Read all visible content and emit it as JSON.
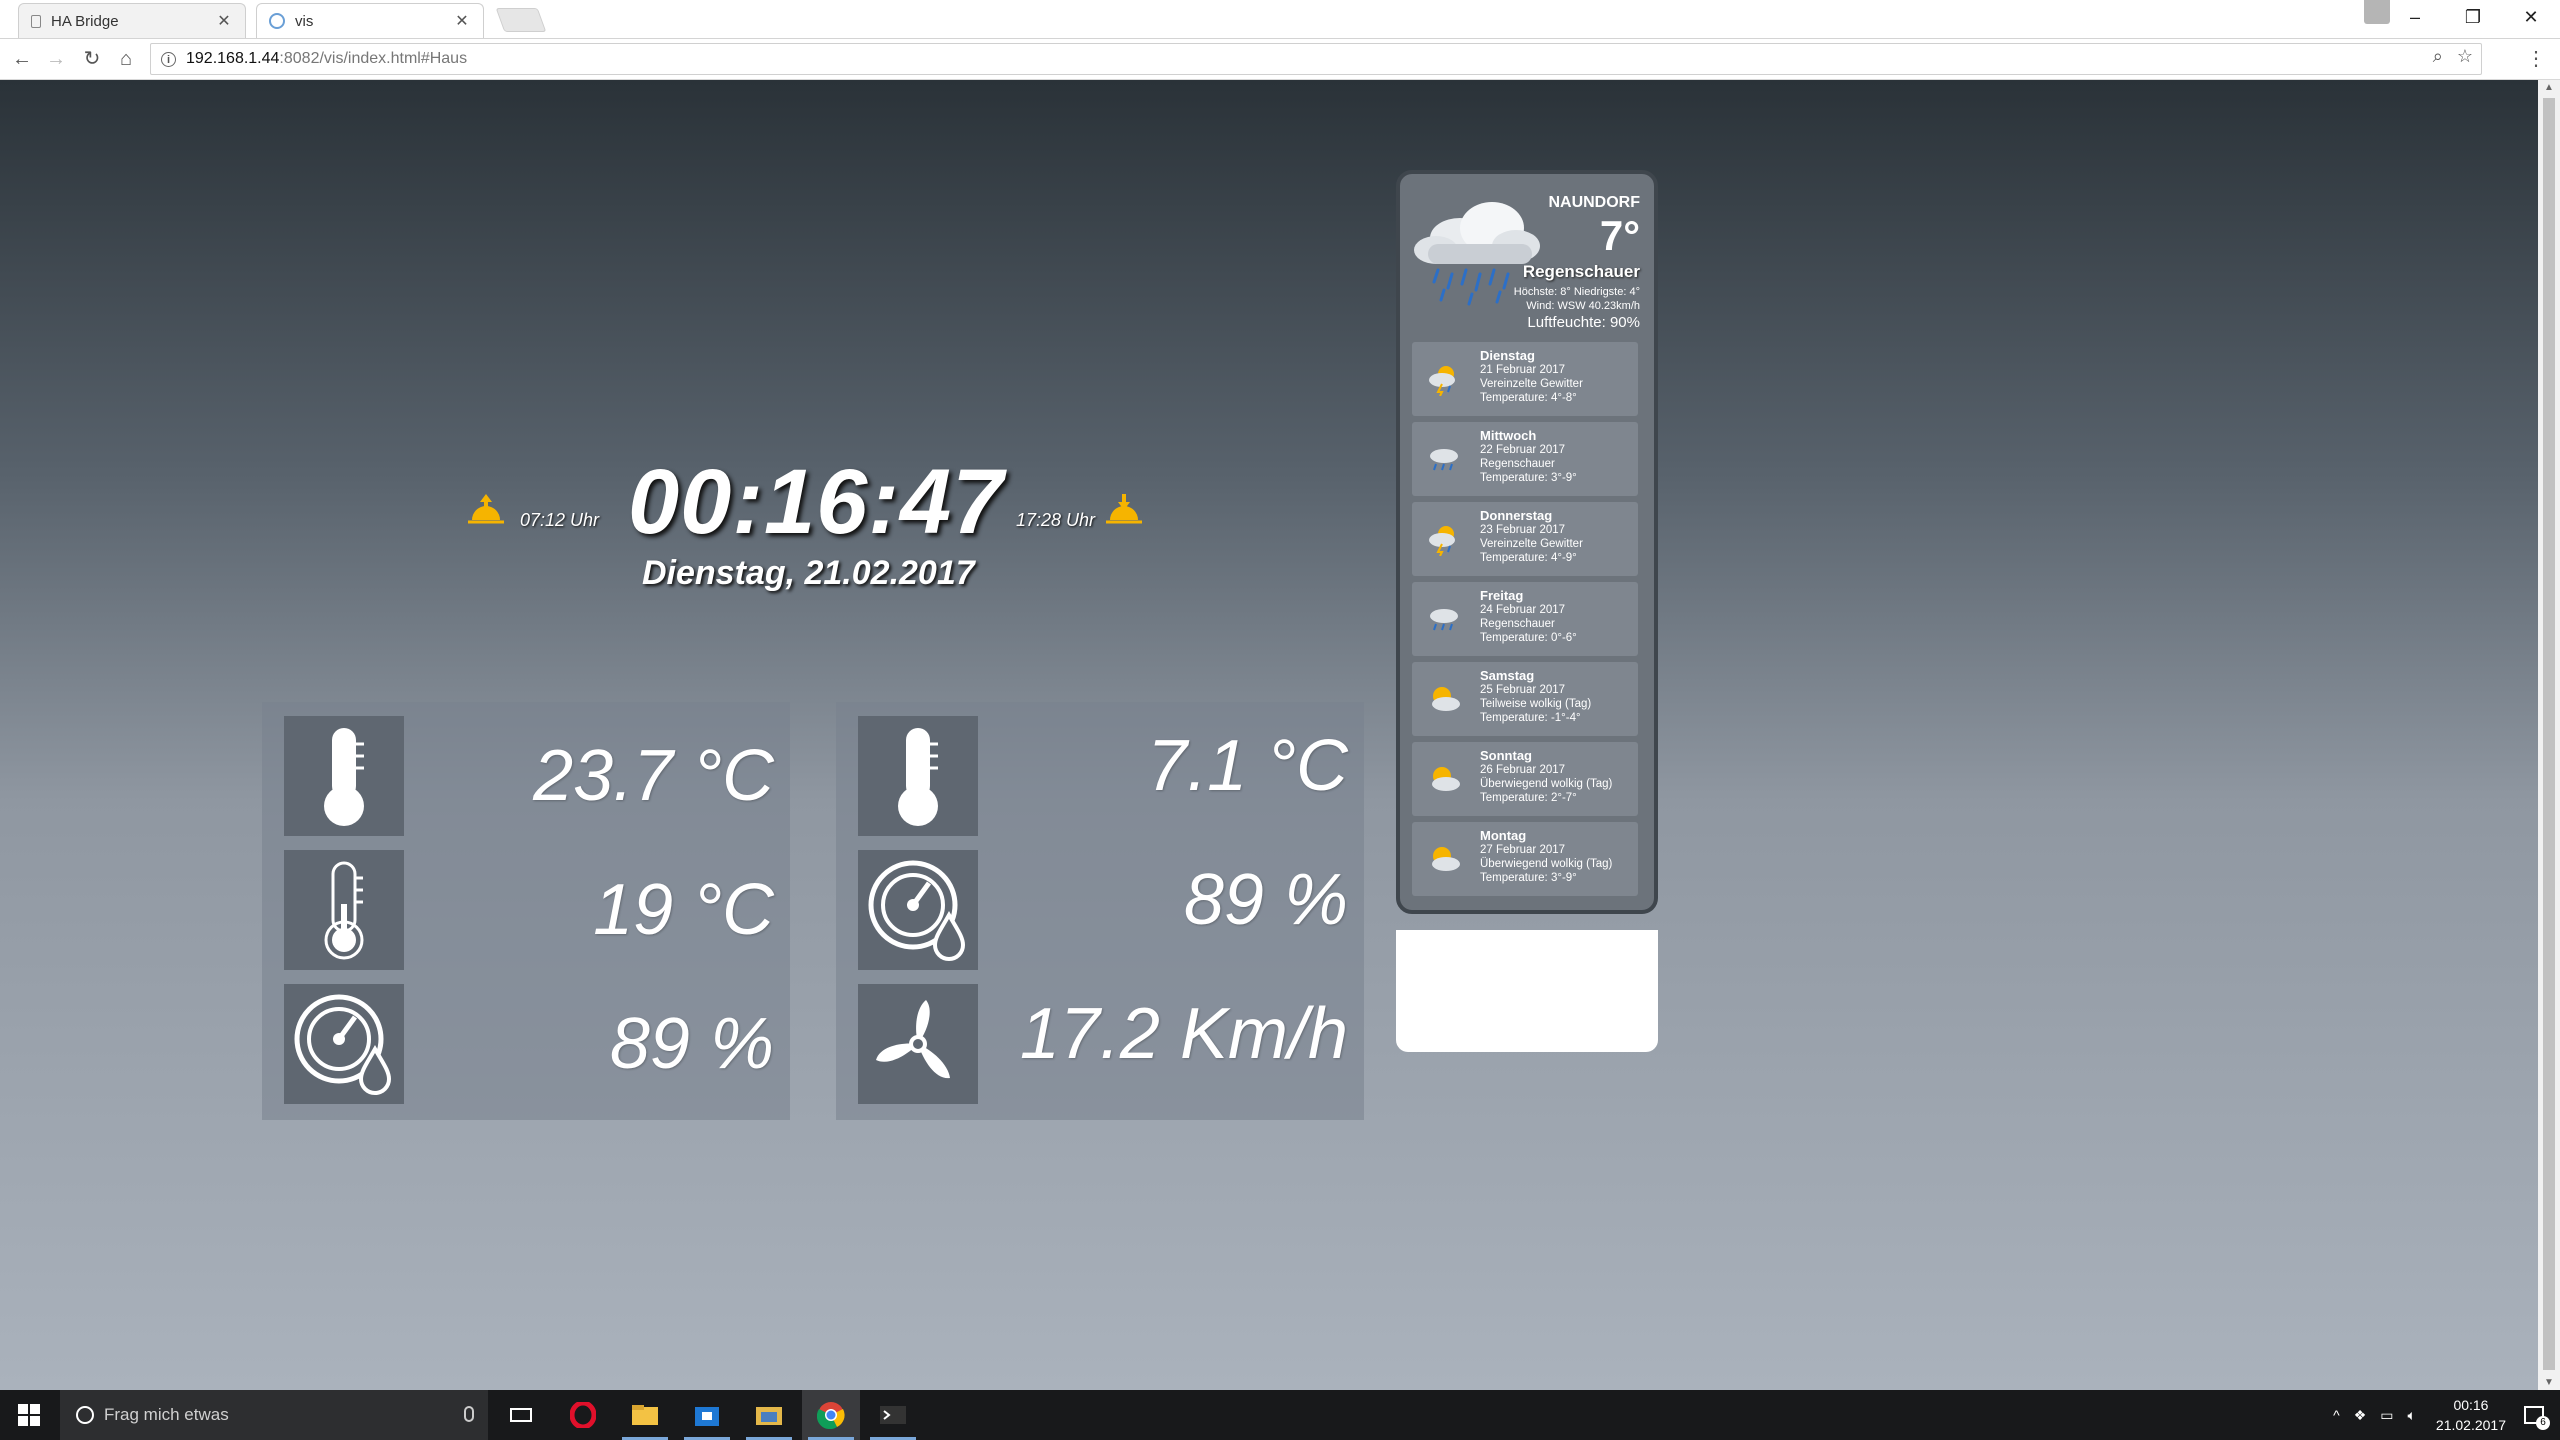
{
  "browser": {
    "tabs": [
      {
        "label": "HA Bridge",
        "active": false
      },
      {
        "label": "vis",
        "active": true
      }
    ],
    "url_host": "192.168.1.44",
    "url_rest": ":8082/vis/index.html#Haus"
  },
  "dashboard": {
    "clock": "00:16:47",
    "date": "Dienstag, 21.02.2017",
    "sunrise": "07:12 Uhr",
    "sunset": "17:28 Uhr",
    "left_panel": [
      {
        "icon": "thermometer-full-icon",
        "value": "23.7 °C"
      },
      {
        "icon": "thermometer-low-icon",
        "value": "19 °C"
      },
      {
        "icon": "humidity-gauge-icon",
        "value": "89 %"
      }
    ],
    "right_panel": [
      {
        "icon": "thermometer-full-icon",
        "value": "7.1 °C"
      },
      {
        "icon": "humidity-gauge-icon",
        "value": "89 %"
      },
      {
        "icon": "wind-turbine-icon",
        "value": "17.2 Km/h"
      }
    ]
  },
  "weather": {
    "city": "NAUNDORF",
    "temp": "7°",
    "condition": "Regenschauer",
    "hilo": "Höchste: 8° Niedrigste: 4°",
    "wind": "Wind: WSW 40.23km/h",
    "humidity": "Luftfeuchte: 90%",
    "forecast": [
      {
        "day": "Dienstag",
        "date": "21 Februar 2017",
        "cond": "Vereinzelte Gewitter",
        "temp": "Temperature: 4°-8°",
        "icon": "storm-sun"
      },
      {
        "day": "Mittwoch",
        "date": "22 Februar 2017",
        "cond": "Regenschauer",
        "temp": "Temperature: 3°-9°",
        "icon": "rain"
      },
      {
        "day": "Donnerstag",
        "date": "23 Februar 2017",
        "cond": "Vereinzelte Gewitter",
        "temp": "Temperature: 4°-9°",
        "icon": "storm-sun"
      },
      {
        "day": "Freitag",
        "date": "24 Februar 2017",
        "cond": "Regenschauer",
        "temp": "Temperature: 0°-6°",
        "icon": "rain"
      },
      {
        "day": "Samstag",
        "date": "25 Februar 2017",
        "cond": "Teilweise wolkig (Tag)",
        "temp": "Temperature: -1°-4°",
        "icon": "partly-cloudy"
      },
      {
        "day": "Sonntag",
        "date": "26 Februar 2017",
        "cond": "Überwiegend wolkig (Tag)",
        "temp": "Temperature: 2°-7°",
        "icon": "partly-cloudy"
      },
      {
        "day": "Montag",
        "date": "27 Februar 2017",
        "cond": "Überwiegend wolkig (Tag)",
        "temp": "Temperature: 3°-9°",
        "icon": "partly-cloudy"
      }
    ]
  },
  "taskbar": {
    "search_placeholder": "Frag mich etwas",
    "time": "00:16",
    "date": "21.02.2017",
    "notification_count": "6"
  }
}
